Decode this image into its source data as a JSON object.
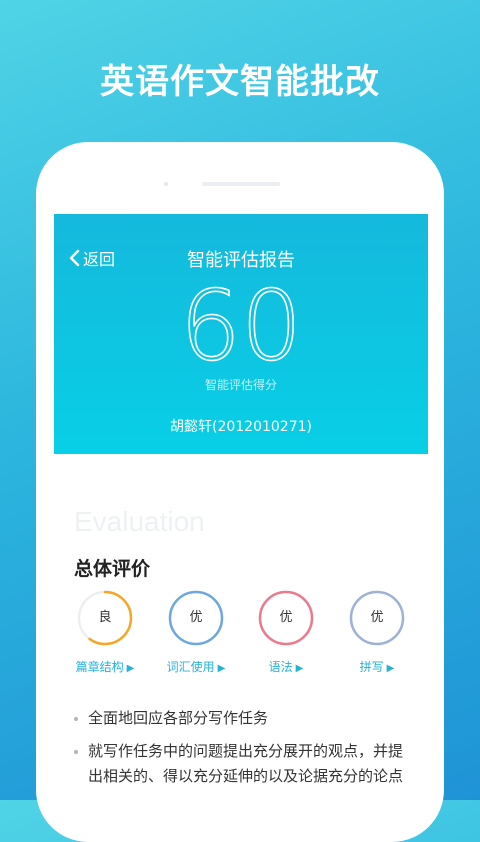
{
  "promo": {
    "title": "英语作文智能批改"
  },
  "header": {
    "back_label": "返回",
    "title": "智能评估报告",
    "score": "60",
    "score_label": "智能评估得分",
    "student": "胡懿轩(2012010271)"
  },
  "evaluation": {
    "watermark": "Evaluation",
    "section_title": "总体评价",
    "ratings": [
      {
        "grade": "良",
        "label": "篇章结构",
        "color": "#f5a623",
        "fill": 0.6
      },
      {
        "grade": "优",
        "label": "词汇使用",
        "color": "#6fa8dc",
        "fill": 1.0
      },
      {
        "grade": "优",
        "label": "语法",
        "color": "#ea7a8e",
        "fill": 1.0
      },
      {
        "grade": "优",
        "label": "拼写",
        "color": "#9fb2d6",
        "fill": 1.0
      }
    ],
    "arrow_glyph": "▶"
  },
  "comments": [
    "全面地回应各部分写作任务",
    "就写作任务中的问题提出充分展开的观点，并提出相关的、得以充分延伸的以及论据充分的论点"
  ],
  "colors": {
    "accent": "#25b2d6",
    "header_top": "#15b9dc",
    "header_bottom": "#08cfe6"
  }
}
